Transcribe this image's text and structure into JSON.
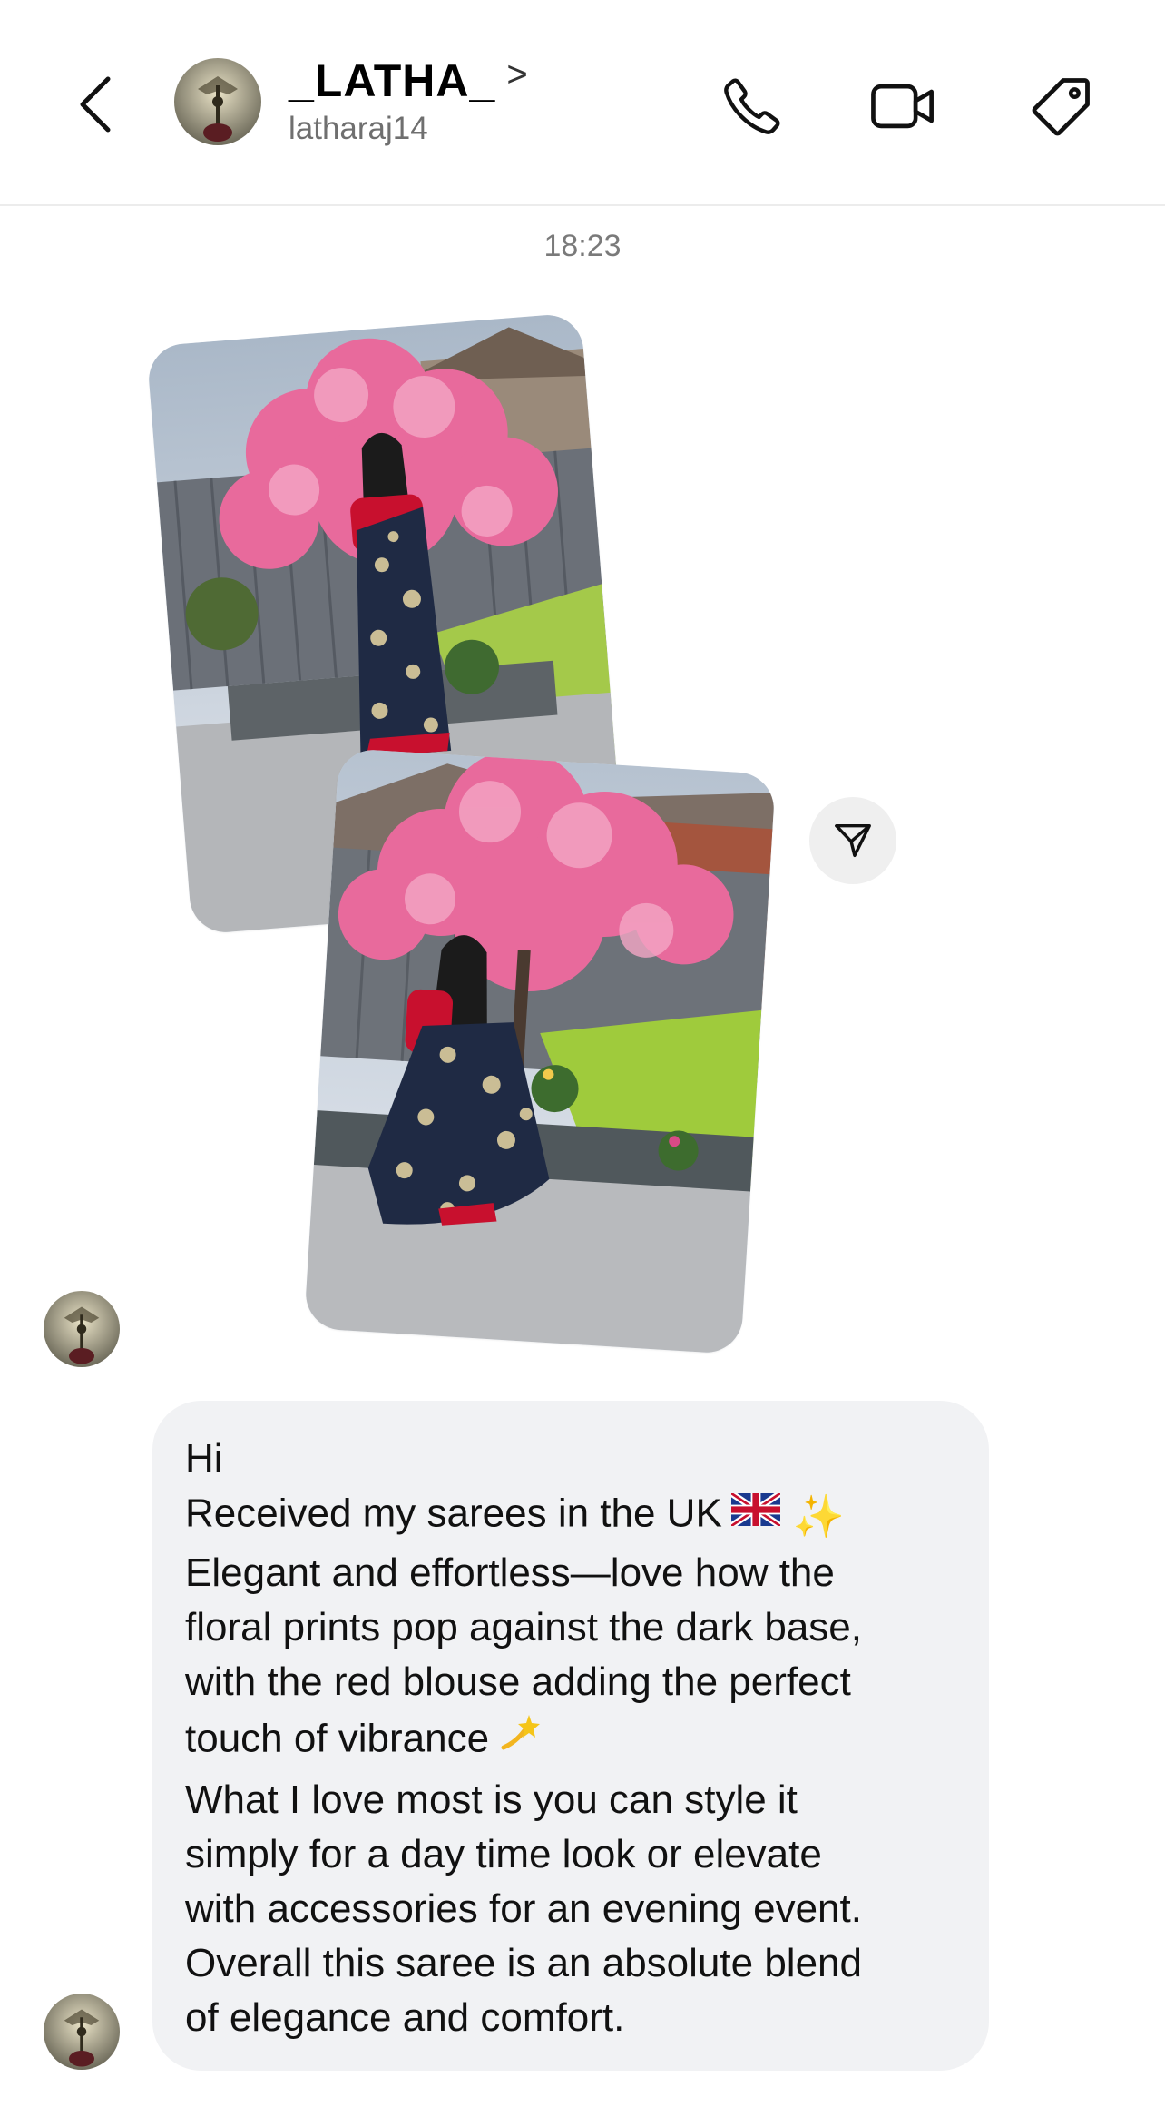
{
  "header": {
    "title": "_LATHA_",
    "chevron": ">",
    "subtitle": "latharaj14",
    "icons": [
      "back-icon",
      "phone-icon",
      "video-camera-icon",
      "tag-icon"
    ]
  },
  "thread": {
    "timestamp": "18:23"
  },
  "message": {
    "line1": "Hi",
    "line2": "Received my sarees in the UK",
    "line3": "Elegant and effortless—love how the",
    "line4": "floral prints pop against the dark base,",
    "line5": "with the red blouse adding the perfect",
    "line6": "touch of vibrance",
    "line7": "What I love most is you can style it",
    "line8": "simply for a day time look or elevate",
    "line9": "with accessories for an evening event.",
    "line10": "Overall this saree is an absolute blend",
    "line11": "of elegance and comfort.",
    "emojis": [
      "uk-flag",
      "sparkles",
      "dizzy"
    ]
  },
  "colors": {
    "bubble": "#f1f2f4",
    "blossom": "#e86a9c",
    "grass": "#9ccc3a",
    "blouse": "#c8102e",
    "saree": "#1f2a44"
  }
}
